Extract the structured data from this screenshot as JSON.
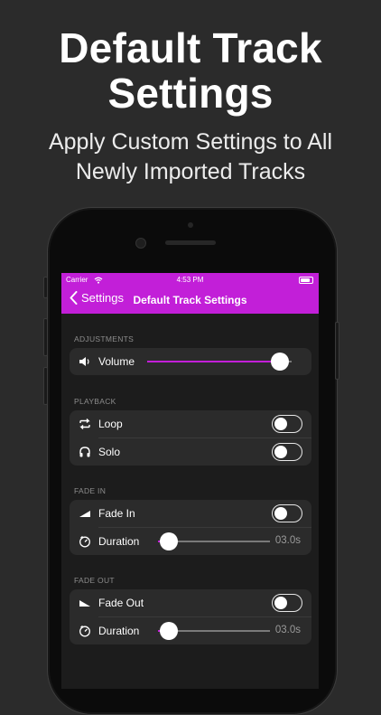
{
  "headline": {
    "line1": "Default Track",
    "line2": "Settings"
  },
  "subtitle": {
    "line1": "Apply Custom Settings to All",
    "line2": "Newly Imported Tracks"
  },
  "status_bar": {
    "carrier": "Carrier",
    "time": "4:53 PM"
  },
  "nav": {
    "back_label": "Settings",
    "title": "Default Track Settings"
  },
  "sections": {
    "adjustments": {
      "label": "ADJUSTMENTS",
      "volume_label": "Volume",
      "volume_level": 0.92
    },
    "playback": {
      "label": "PLAYBACK",
      "loop_label": "Loop",
      "loop_on": false,
      "solo_label": "Solo",
      "solo_on": false
    },
    "fade_in": {
      "label": "FADE IN",
      "toggle_label": "Fade In",
      "toggle_on": false,
      "duration_label": "Duration",
      "duration_value": "03.0s",
      "duration_level": 0.1
    },
    "fade_out": {
      "label": "FADE OUT",
      "toggle_label": "Fade Out",
      "toggle_on": false,
      "duration_label": "Duration",
      "duration_value": "03.0s",
      "duration_level": 0.1
    }
  },
  "colors": {
    "accent": "#c21fd8",
    "background": "#2b2b2b"
  },
  "icons": {
    "volume": "speaker-icon",
    "loop": "repeat-icon",
    "solo": "headphones-icon",
    "fade_in": "fade-in-ramp-icon",
    "fade_out": "fade-out-ramp-icon",
    "duration": "timer-icon"
  }
}
